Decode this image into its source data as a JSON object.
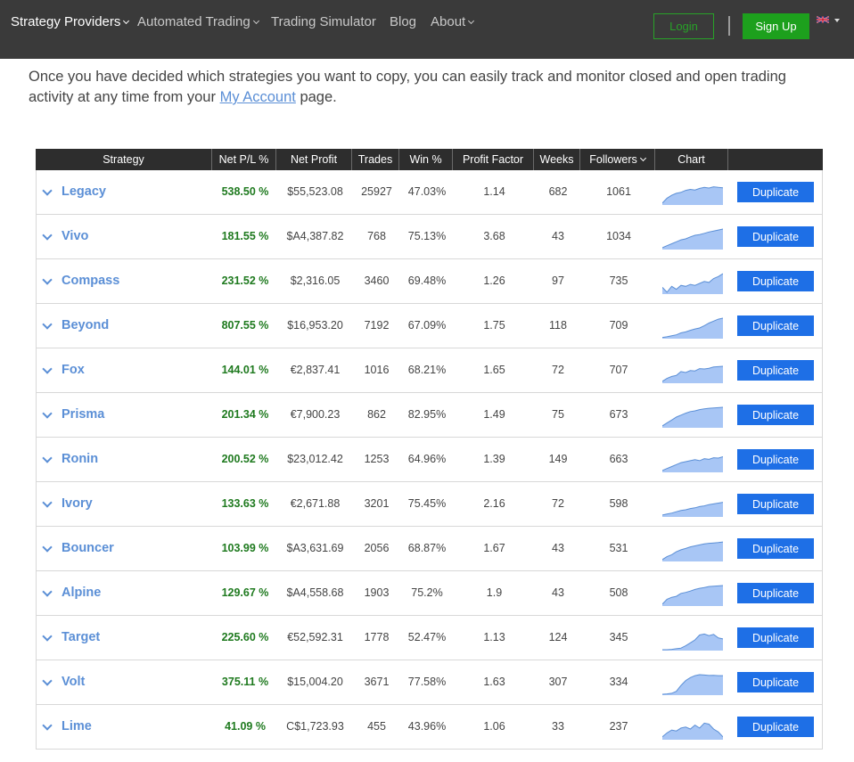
{
  "nav": {
    "items": [
      {
        "label": "Strategy Providers",
        "caret": true
      },
      {
        "label": "Automated Trading",
        "caret": true
      },
      {
        "label": "Trading Simulator",
        "caret": false
      },
      {
        "label": "Blog",
        "caret": false
      },
      {
        "label": "About",
        "caret": true
      }
    ],
    "login": "Login",
    "signup": "Sign Up",
    "language_icon": "uk-flag-icon"
  },
  "intro": {
    "text_before": "Once you have decided which strategies you want to copy, you can easily track and monitor closed and open trading activity at any time from your ",
    "link": "My Account",
    "text_after": " page."
  },
  "table": {
    "headers": {
      "strategy": "Strategy",
      "net_pl": "Net P/L %",
      "net_profit": "Net Profit",
      "trades": "Trades",
      "win": "Win %",
      "profit_factor": "Profit Factor",
      "weeks": "Weeks",
      "followers": "Followers",
      "chart": "Chart"
    },
    "button_label": "Duplicate",
    "rows": [
      {
        "name": "Legacy",
        "net_pl": "538.50 %",
        "net_profit": "$55,523.08",
        "trades": "25927",
        "win": "47.03%",
        "pf": "1.14",
        "weeks": "682",
        "followers": "1061",
        "spark": [
          0.05,
          0.3,
          0.45,
          0.55,
          0.6,
          0.7,
          0.75,
          0.72,
          0.8,
          0.85,
          0.82,
          0.88,
          0.85,
          0.83
        ]
      },
      {
        "name": "Vivo",
        "net_pl": "181.55 %",
        "net_profit": "$A4,387.82",
        "trades": "768",
        "win": "75.13%",
        "pf": "3.68",
        "weeks": "43",
        "followers": "1034",
        "spark": [
          0.05,
          0.15,
          0.25,
          0.35,
          0.45,
          0.5,
          0.6,
          0.68,
          0.72,
          0.78,
          0.85,
          0.9,
          0.95,
          1.0
        ]
      },
      {
        "name": "Compass",
        "net_pl": "231.52 %",
        "net_profit": "$2,316.05",
        "trades": "3460",
        "win": "69.48%",
        "pf": "1.26",
        "weeks": "97",
        "followers": "735",
        "spark": [
          0.3,
          0.05,
          0.35,
          0.2,
          0.4,
          0.35,
          0.45,
          0.4,
          0.5,
          0.6,
          0.55,
          0.75,
          0.85,
          1.0
        ]
      },
      {
        "name": "Beyond",
        "net_pl": "807.55 %",
        "net_profit": "$16,953.20",
        "trades": "7192",
        "win": "67.09%",
        "pf": "1.75",
        "weeks": "118",
        "followers": "709",
        "spark": [
          0.02,
          0.05,
          0.1,
          0.15,
          0.25,
          0.3,
          0.38,
          0.45,
          0.5,
          0.62,
          0.75,
          0.85,
          0.95,
          1.0
        ]
      },
      {
        "name": "Fox",
        "net_pl": "144.01 %",
        "net_profit": "€2,837.41",
        "trades": "1016",
        "win": "68.21%",
        "pf": "1.65",
        "weeks": "72",
        "followers": "707",
        "spark": [
          0.05,
          0.2,
          0.3,
          0.35,
          0.55,
          0.5,
          0.6,
          0.58,
          0.7,
          0.68,
          0.72,
          0.78,
          0.8,
          0.82
        ]
      },
      {
        "name": "Prisma",
        "net_pl": "201.34 %",
        "net_profit": "€7,900.23",
        "trades": "862",
        "win": "82.95%",
        "pf": "1.49",
        "weeks": "75",
        "followers": "673",
        "spark": [
          0.05,
          0.2,
          0.35,
          0.5,
          0.6,
          0.7,
          0.78,
          0.82,
          0.88,
          0.92,
          0.95,
          0.97,
          0.98,
          1.0
        ]
      },
      {
        "name": "Ronin",
        "net_pl": "200.52 %",
        "net_profit": "$23,012.42",
        "trades": "1253",
        "win": "64.96%",
        "pf": "1.39",
        "weeks": "149",
        "followers": "663",
        "spark": [
          0.05,
          0.15,
          0.25,
          0.35,
          0.45,
          0.5,
          0.55,
          0.6,
          0.55,
          0.65,
          0.62,
          0.7,
          0.68,
          0.75
        ]
      },
      {
        "name": "Ivory",
        "net_pl": "133.63 %",
        "net_profit": "€2,671.88",
        "trades": "3201",
        "win": "75.45%",
        "pf": "2.16",
        "weeks": "72",
        "followers": "598",
        "spark": [
          0.05,
          0.1,
          0.15,
          0.22,
          0.28,
          0.32,
          0.38,
          0.42,
          0.48,
          0.52,
          0.58,
          0.62,
          0.66,
          0.7
        ]
      },
      {
        "name": "Bouncer",
        "net_pl": "103.99 %",
        "net_profit": "$A3,631.69",
        "trades": "2056",
        "win": "68.87%",
        "pf": "1.67",
        "weeks": "43",
        "followers": "531",
        "spark": [
          0.05,
          0.2,
          0.3,
          0.45,
          0.55,
          0.62,
          0.7,
          0.75,
          0.8,
          0.85,
          0.88,
          0.9,
          0.92,
          0.95
        ]
      },
      {
        "name": "Alpine",
        "net_pl": "129.67 %",
        "net_profit": "$A4,558.68",
        "trades": "1903",
        "win": "75.2%",
        "pf": "1.9",
        "weeks": "43",
        "followers": "508",
        "spark": [
          0.05,
          0.3,
          0.4,
          0.45,
          0.6,
          0.65,
          0.72,
          0.8,
          0.86,
          0.9,
          0.95,
          0.97,
          0.98,
          1.0
        ]
      },
      {
        "name": "Target",
        "net_pl": "225.60 %",
        "net_profit": "€52,592.31",
        "trades": "1778",
        "win": "52.47%",
        "pf": "1.13",
        "weeks": "124",
        "followers": "345",
        "spark": [
          0.0,
          0.0,
          0.02,
          0.05,
          0.08,
          0.2,
          0.35,
          0.5,
          0.75,
          0.8,
          0.72,
          0.78,
          0.6,
          0.55
        ]
      },
      {
        "name": "Volt",
        "net_pl": "375.11 %",
        "net_profit": "$15,004.20",
        "trades": "3671",
        "win": "77.58%",
        "pf": "1.63",
        "weeks": "307",
        "followers": "334",
        "spark": [
          0.0,
          0.02,
          0.05,
          0.15,
          0.45,
          0.7,
          0.85,
          0.95,
          1.0,
          0.98,
          0.96,
          0.97,
          0.95,
          0.95
        ]
      },
      {
        "name": "Lime",
        "net_pl": "41.09 %",
        "net_profit": "C$1,723.93",
        "trades": "455",
        "win": "43.96%",
        "pf": "1.06",
        "weeks": "33",
        "followers": "237",
        "spark": [
          0.1,
          0.3,
          0.45,
          0.4,
          0.55,
          0.6,
          0.5,
          0.7,
          0.55,
          0.8,
          0.75,
          0.5,
          0.35,
          0.1
        ]
      }
    ]
  },
  "colors": {
    "nav_bg": "#3a3a3a",
    "link_blue": "#5b8fd6",
    "profit_green": "#1f7a1f",
    "button_blue": "#1e6fe6",
    "signup_green": "#1da01d",
    "spark_fill": "#a8c6f5",
    "spark_line": "#5b8fd6"
  }
}
